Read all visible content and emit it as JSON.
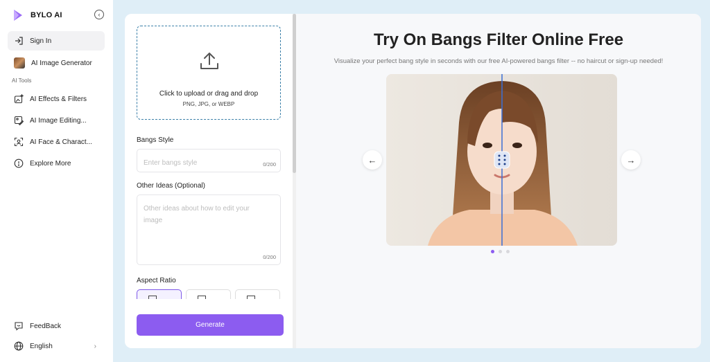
{
  "brand": {
    "name": "BYLO AI"
  },
  "sidebar": {
    "sign_in": "Sign In",
    "image_generator": "AI Image Generator",
    "section_label": "AI Tools",
    "items": [
      {
        "label": "AI Effects & Filters",
        "icon": "sparkle-image-icon"
      },
      {
        "label": "AI Image Editing...",
        "icon": "image-edit-icon"
      },
      {
        "label": "AI Face & Charact...",
        "icon": "face-scan-icon"
      },
      {
        "label": "Explore More",
        "icon": "compass-icon"
      }
    ],
    "feedback": "FeedBack",
    "language": "English"
  },
  "form": {
    "upload_line1": "Click to upload or drag and drop",
    "upload_line2": "PNG, JPG, or WEBP",
    "bangs_label": "Bangs Style",
    "bangs_placeholder": "Enter bangs style",
    "bangs_count": "0/200",
    "ideas_label": "Other Ideas (Optional)",
    "ideas_placeholder": "Other ideas about how to edit your image",
    "ideas_count": "0/200",
    "aspect_label": "Aspect Ratio",
    "generate": "Generate"
  },
  "preview": {
    "title": "Try On Bangs Filter Online Free",
    "subtitle": "Visualize your perfect bang style in seconds with our free AI-powered bangs filter -- no haircut or sign-up needed!",
    "prev_arrow": "←",
    "next_arrow": "→",
    "active_slide": 1,
    "slide_count": 3
  },
  "colors": {
    "accent": "#8c5cf0",
    "divider": "#3b6fd6",
    "background": "#dfeef7"
  }
}
